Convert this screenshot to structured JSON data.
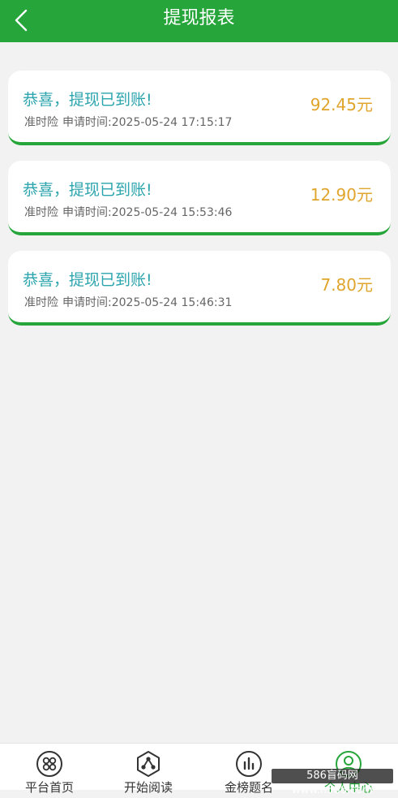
{
  "header": {
    "title": "提现报表"
  },
  "records": [
    {
      "title": "恭喜，提现已到账!",
      "type": "准时险",
      "apply_time": "申请时间:2025-05-24 17:15:17",
      "amount": "92.45元"
    },
    {
      "title": "恭喜，提现已到账!",
      "type": "准时险",
      "apply_time": "申请时间:2025-05-24 15:53:46",
      "amount": "12.90元"
    },
    {
      "title": "恭喜，提现已到账!",
      "type": "准时险",
      "apply_time": "申请时间:2025-05-24 15:46:31",
      "amount": "7.80元"
    }
  ],
  "tabbar": {
    "items": [
      {
        "label": "平台首页",
        "icon": "home-grid-icon"
      },
      {
        "label": "开始阅读",
        "icon": "read-hex-icon"
      },
      {
        "label": "金榜题名",
        "icon": "ranking-chart-icon"
      },
      {
        "label": "个人中心",
        "icon": "user-icon"
      }
    ],
    "active_index": 3
  },
  "watermark": {
    "text": "586盲码网 www.h586.com"
  },
  "colors": {
    "brand_green": "#25a53a",
    "title_teal": "#2ba4ad",
    "amount_orange": "#e0a52c"
  }
}
